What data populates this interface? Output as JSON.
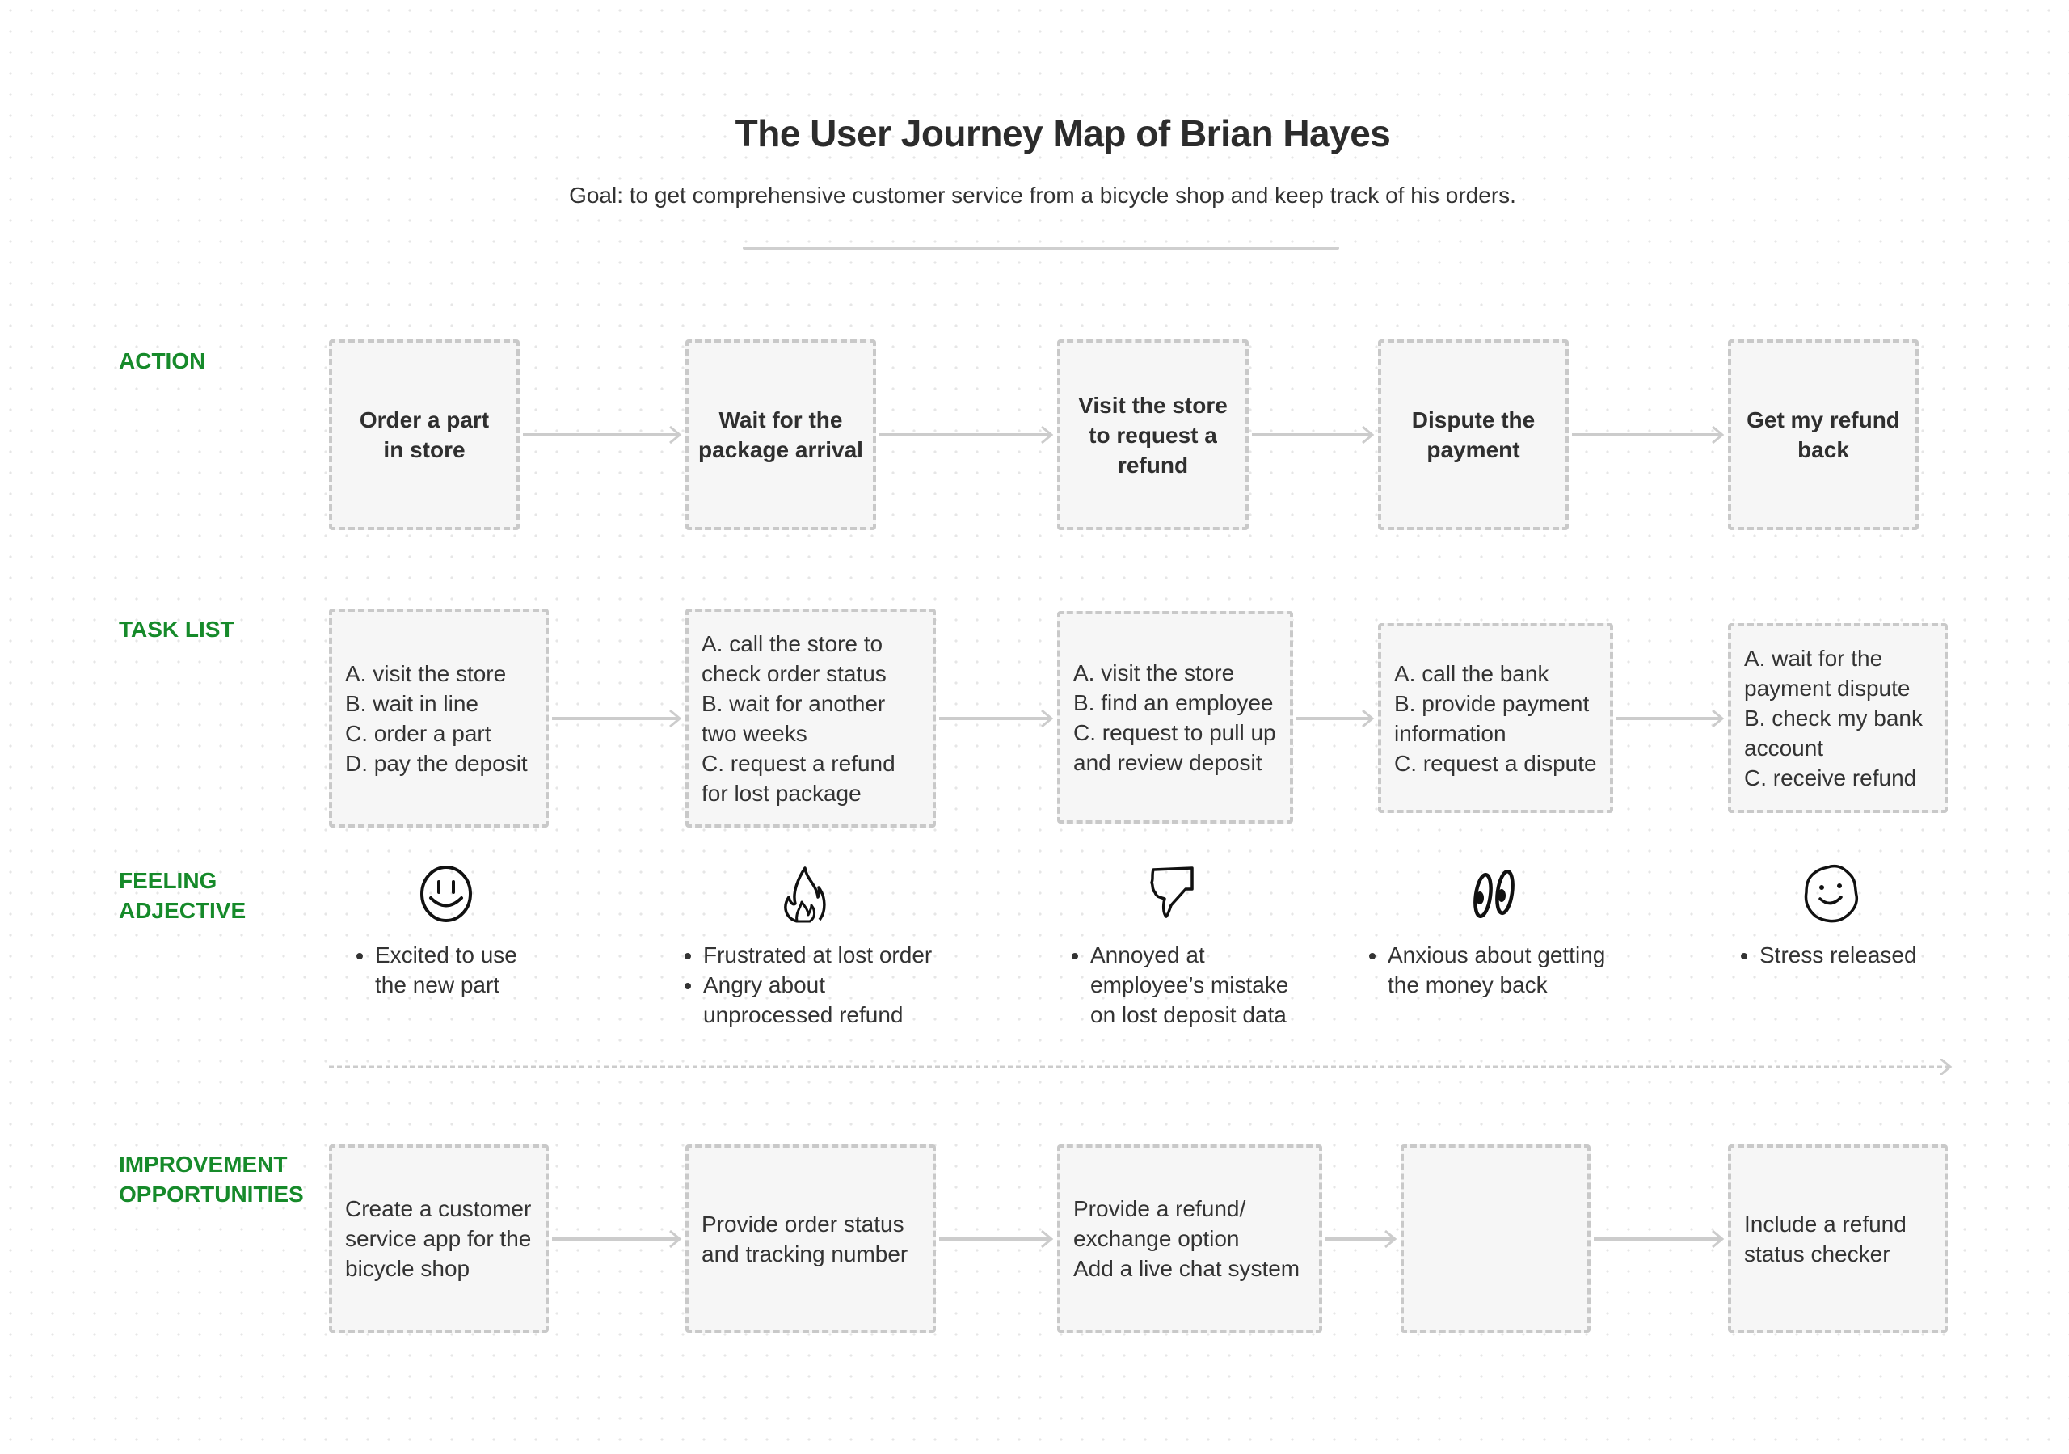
{
  "header": {
    "title": "The User Journey Map of Brian Hayes",
    "goal": "Goal: to get comprehensive customer service from a bicycle shop and keep track of his orders."
  },
  "colors": {
    "label_green": "#168a2a",
    "box_fill": "#f6f6f6",
    "box_border": "#c9c9c9",
    "arrow": "#cccccc",
    "text": "#2f2f2f"
  },
  "rows": {
    "action_label": "ACTION",
    "task_label": "TASK LIST",
    "feeling_label": "FEELING\nADJECTIVE",
    "improvement_label": "IMPROVEMENT\nOPPORTUNITIES"
  },
  "actions": [
    "Order a part\nin store",
    "Wait for the\npackage arrival",
    "Visit the store\nto request a\nrefund",
    "Dispute the\npayment",
    "Get my refund\nback"
  ],
  "tasks": [
    "A. visit the store\nB. wait in line\nC. order a part\nD. pay the deposit",
    "A. call the store to\ncheck order status\nB. wait for another\ntwo weeks\nC. request a refund\nfor lost package",
    "A. visit the store\nB. find an employee\nC. request to pull up\nand review deposit",
    "A. call the bank\nB. provide payment\ninformation\nC. request a dispute",
    "A. wait for the\npayment dispute\nB. check my bank\naccount\nC. receive refund"
  ],
  "feelings": [
    {
      "icon": "smiley-face-icon",
      "items": [
        "Excited to use\nthe new part"
      ]
    },
    {
      "icon": "fire-icon",
      "items": [
        "Frustrated at lost order",
        "Angry about\nunprocessed refund"
      ]
    },
    {
      "icon": "thumbs-down-icon",
      "items": [
        "Annoyed at\nemployee’s mistake\non lost deposit data"
      ]
    },
    {
      "icon": "wide-eyes-icon",
      "items": [
        "Anxious about getting\nthe money back"
      ]
    },
    {
      "icon": "relieved-face-icon",
      "items": [
        "Stress released"
      ]
    }
  ],
  "improvements": [
    "Create a customer\nservice app for the\nbicycle shop",
    "Provide order status\nand tracking number",
    "Provide a refund/\nexchange option\nAdd a live chat system",
    "",
    "Include a refund\nstatus checker"
  ]
}
